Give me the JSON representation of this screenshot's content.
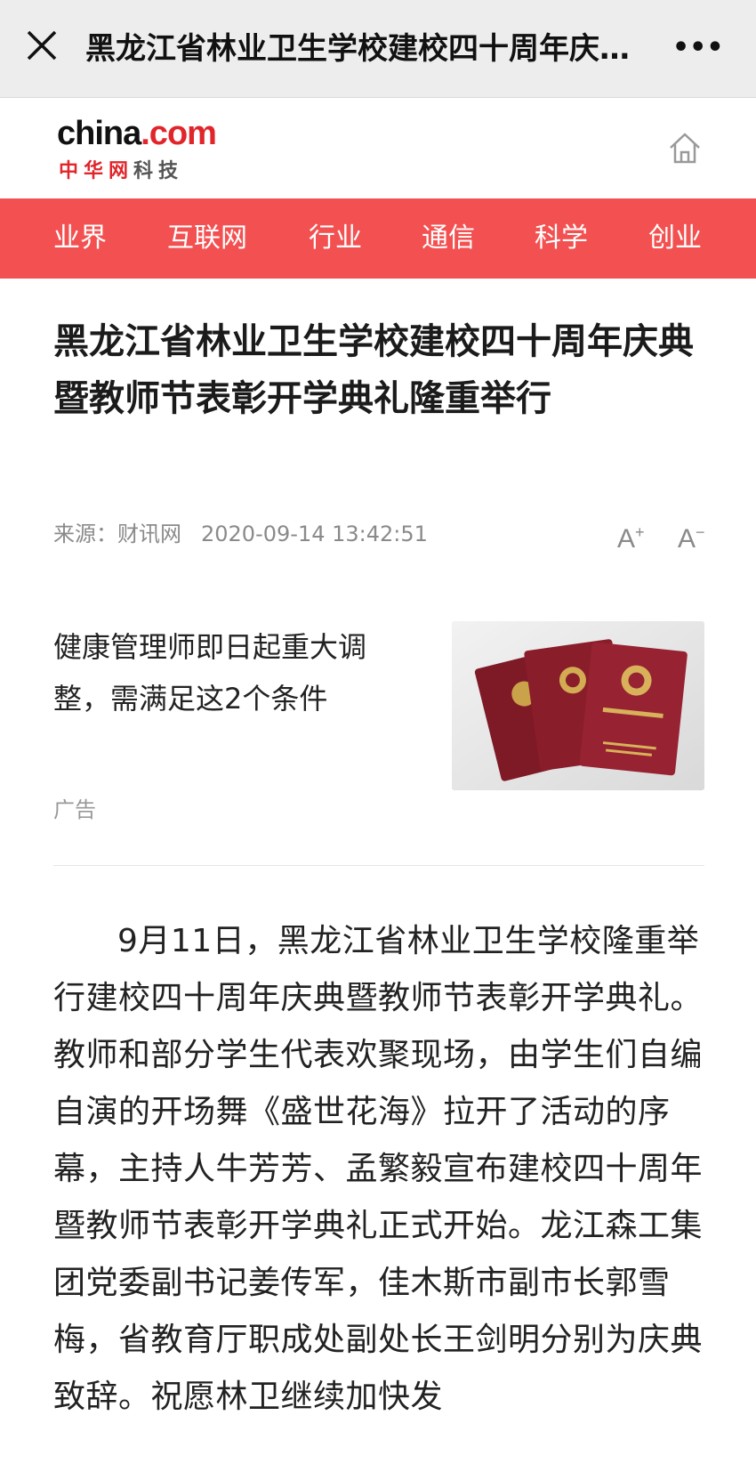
{
  "topbar": {
    "title": "黑龙江省林业卫生学校建校四十周年庆典暨教师节表彰开学典礼隆重举行",
    "more_label": "•••"
  },
  "brand": {
    "logo_en_black": "china",
    "logo_en_red": ".com",
    "logo_cn_red": "中华网",
    "logo_cn_gray": "科技"
  },
  "nav": {
    "items": [
      {
        "label": "业界"
      },
      {
        "label": "互联网"
      },
      {
        "label": "行业"
      },
      {
        "label": "通信"
      },
      {
        "label": "科学"
      },
      {
        "label": "创业"
      }
    ]
  },
  "article": {
    "headline": "黑龙江省林业卫生学校建校四十周年庆典暨教师节表彰开学典礼隆重举行",
    "source": "来源：财讯网",
    "datetime": "2020-09-14 13:42:51",
    "font_increase": "A",
    "font_decrease": "A",
    "body": "9月11日，黑龙江省林业卫生学校隆重举行建校四十周年庆典暨教师节表彰开学典礼。教师和部分学生代表欢聚现场，由学生们自编自演的开场舞《盛世花海》拉开了活动的序幕，主持人牛芳芳、孟繁毅宣布建校四十周年暨教师节表彰开学典礼正式开始。龙江森工集团党委副书记姜传军，佳木斯市副市长郭雪梅，省教育厅职成处副处长王剑明分别为庆典致辞。祝愿林卫继续加快发"
  },
  "ad": {
    "title": "健康管理师即日起重大调整，需满足这2个条件",
    "label": "广告"
  },
  "colors": {
    "nav_bg": "#f35151",
    "brand_red": "#e0262b",
    "certificate": "#8e1f2c"
  }
}
